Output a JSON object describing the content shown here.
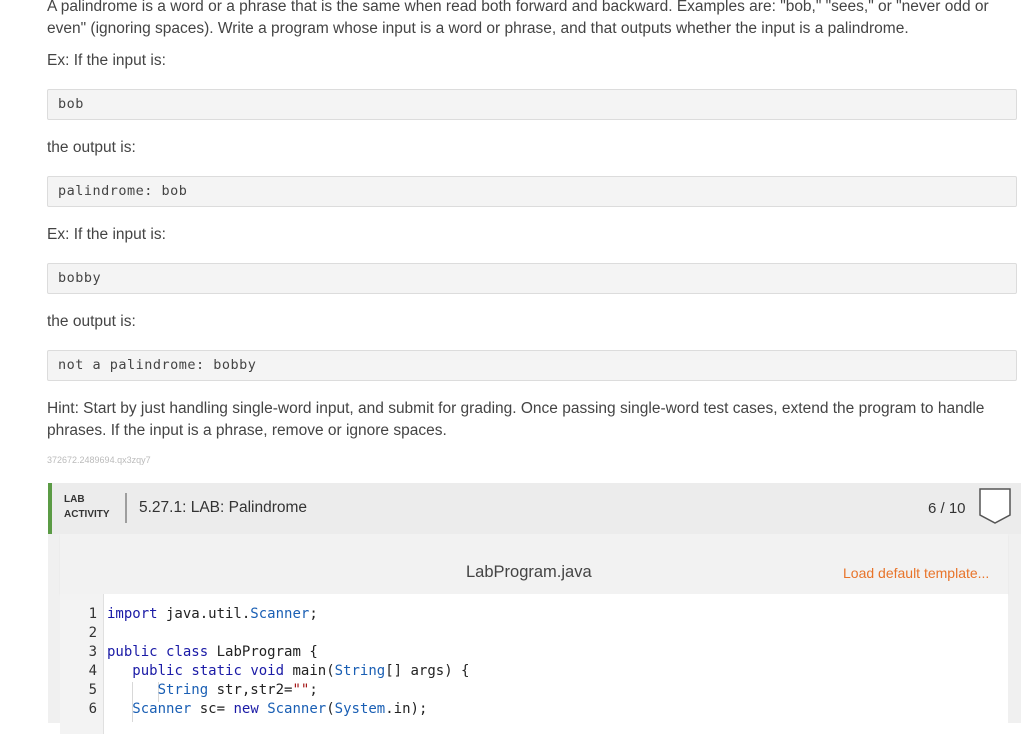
{
  "problem": {
    "intro": "A palindrome is a word or a phrase that is the same when read both forward and backward. Examples are: \"bob,\" \"sees,\" or \"never odd or even\" (ignoring spaces). Write a program whose input is a word or phrase, and that outputs whether the input is a palindrome.",
    "examples": [
      {
        "input_label": "Ex: If the input is:",
        "input": "bob",
        "output_label": "the output is:",
        "output": "palindrome: bob"
      },
      {
        "input_label": "Ex: If the input is:",
        "input": "bobby",
        "output_label": "the output is:",
        "output": "not a palindrome: bobby"
      }
    ],
    "hint": "Hint: Start by just handling single-word input, and submit for grading. Once passing single-word test cases, extend the program to handle phrases. If the input is a phrase, remove or ignore spaces.",
    "id": "372672.2489694.qx3zqy7"
  },
  "lab": {
    "tag_line1": "LAB",
    "tag_line2": "ACTIVITY",
    "title": "5.27.1: LAB: Palindrome",
    "score": "6 / 10",
    "accent_color": "#5b9b45",
    "badge_icon": "shield-icon"
  },
  "editor": {
    "file_name": "LabProgram.java",
    "load_default_label": "Load default template...",
    "link_color": "#e8742a",
    "line_numbers": [
      "1",
      "2",
      "3",
      "4",
      "5",
      "6"
    ],
    "lines": [
      "import java.util.Scanner;",
      "",
      "public class LabProgram {",
      "   public static void main(String[] args) {",
      "      String str,str2=\"\";",
      "   Scanner sc= new Scanner(System.in);"
    ]
  }
}
